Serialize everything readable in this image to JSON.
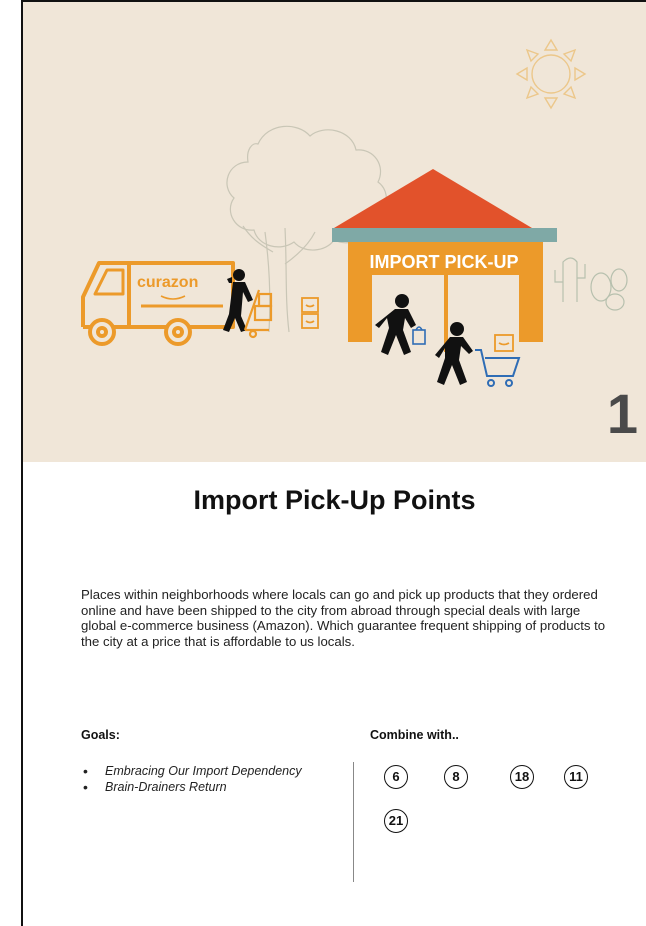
{
  "hero": {
    "truck_brand": "curazon",
    "store_sign": "IMPORT PICK-UP",
    "card_number": "1",
    "icons": [
      "sun-icon",
      "tree-icon",
      "delivery-truck-icon",
      "delivery-person-icon",
      "package-icon",
      "store-icon",
      "shopper-icon",
      "shopping-cart-icon",
      "cactus-icon"
    ]
  },
  "title": "Import Pick-Up Points",
  "description": "Places within neighborhoods where locals can go and pick up products that they ordered online and have been shipped to the city from abroad through special deals with large global e-commerce business (Amazon). Which guarantee frequent shipping of products to the city at a price that is affordable to us locals.",
  "goals": {
    "heading": "Goals:",
    "items": [
      "Embracing Our Import Dependency",
      "Brain-Drainers Return"
    ]
  },
  "combine": {
    "heading": "Combine with..",
    "items": [
      "6",
      "8",
      "18",
      "11",
      "21"
    ]
  },
  "colors": {
    "background": "#f0e6d8",
    "orange": "#ec9a2a",
    "roof": "#e2522b",
    "band": "#7fa9a6",
    "cart": "#2f6db5"
  }
}
